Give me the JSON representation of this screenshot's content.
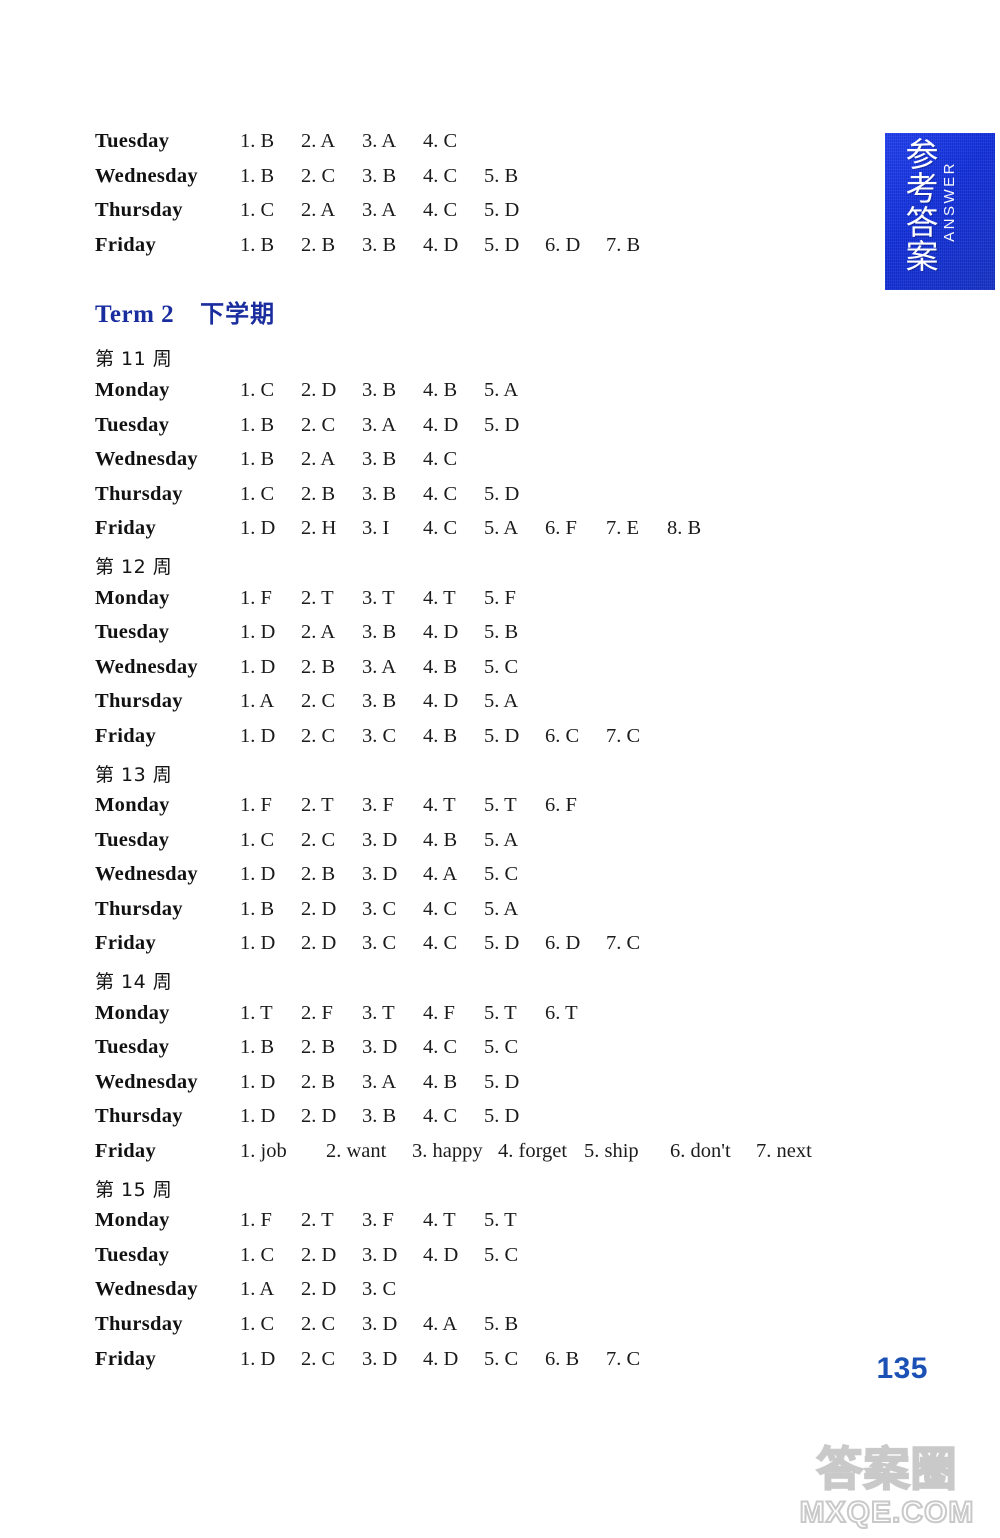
{
  "side_tab": {
    "chinese_label": "参考答案",
    "english_label": "ANSWER",
    "color": "#1432e6"
  },
  "top_block": {
    "rows": [
      {
        "day": "Tuesday",
        "answers": [
          "1. B",
          "2. A",
          "3. A",
          "4. C"
        ]
      },
      {
        "day": "Wednesday",
        "answers": [
          "1. B",
          "2. C",
          "3. B",
          "4. C",
          "5. B"
        ]
      },
      {
        "day": "Thursday",
        "answers": [
          "1. C",
          "2. A",
          "3. A",
          "4. C",
          "5. D"
        ]
      },
      {
        "day": "Friday",
        "answers": [
          "1. B",
          "2. B",
          "3. B",
          "4. D",
          "5. D",
          "6. D",
          "7. B"
        ]
      }
    ]
  },
  "term": {
    "english": "Term 2",
    "chinese": "下学期",
    "color": "#1a2d9e"
  },
  "weeks": [
    {
      "heading": "第 11 周",
      "rows": [
        {
          "day": "Monday",
          "answers": [
            "1. C",
            "2. D",
            "3. B",
            "4. B",
            "5. A"
          ]
        },
        {
          "day": "Tuesday",
          "answers": [
            "1. B",
            "2. C",
            "3. A",
            "4. D",
            "5. D"
          ]
        },
        {
          "day": "Wednesday",
          "answers": [
            "1. B",
            "2. A",
            "3. B",
            "4. C"
          ]
        },
        {
          "day": "Thursday",
          "answers": [
            "1. C",
            "2. B",
            "3. B",
            "4. C",
            "5. D"
          ]
        },
        {
          "day": "Friday",
          "answers": [
            "1. D",
            "2. H",
            "3. I",
            "4. C",
            "5. A",
            "6. F",
            "7. E",
            "8. B"
          ]
        }
      ]
    },
    {
      "heading": "第 12 周",
      "rows": [
        {
          "day": "Monday",
          "answers": [
            "1. F",
            "2. T",
            "3. T",
            "4. T",
            "5. F"
          ]
        },
        {
          "day": "Tuesday",
          "answers": [
            "1. D",
            "2. A",
            "3. B",
            "4. D",
            "5. B"
          ]
        },
        {
          "day": "Wednesday",
          "answers": [
            "1. D",
            "2. B",
            "3. A",
            "4. B",
            "5. C"
          ]
        },
        {
          "day": "Thursday",
          "answers": [
            "1. A",
            "2. C",
            "3. B",
            "4. D",
            "5. A"
          ]
        },
        {
          "day": "Friday",
          "answers": [
            "1. D",
            "2. C",
            "3. C",
            "4. B",
            "5. D",
            "6. C",
            "7. C"
          ]
        }
      ]
    },
    {
      "heading": "第 13 周",
      "rows": [
        {
          "day": "Monday",
          "answers": [
            "1. F",
            "2. T",
            "3. F",
            "4. T",
            "5. T",
            "6. F"
          ]
        },
        {
          "day": "Tuesday",
          "answers": [
            "1. C",
            "2. C",
            "3. D",
            "4. B",
            "5. A"
          ]
        },
        {
          "day": "Wednesday",
          "answers": [
            "1. D",
            "2. B",
            "3. D",
            "4. A",
            "5. C"
          ]
        },
        {
          "day": "Thursday",
          "answers": [
            "1. B",
            "2. D",
            "3. C",
            "4. C",
            "5. A"
          ]
        },
        {
          "day": "Friday",
          "answers": [
            "1. D",
            "2. D",
            "3. C",
            "4. C",
            "5. D",
            "6. D",
            "7. C"
          ]
        }
      ]
    },
    {
      "heading": "第 14 周",
      "rows": [
        {
          "day": "Monday",
          "answers": [
            "1. T",
            "2. F",
            "3. T",
            "4. F",
            "5. T",
            "6. T"
          ]
        },
        {
          "day": "Tuesday",
          "answers": [
            "1. B",
            "2. B",
            "3. D",
            "4. C",
            "5. C"
          ]
        },
        {
          "day": "Wednesday",
          "answers": [
            "1. D",
            "2. B",
            "3. A",
            "4. B",
            "5. D"
          ]
        },
        {
          "day": "Thursday",
          "answers": [
            "1. D",
            "2. D",
            "3. B",
            "4. C",
            "5. D"
          ]
        },
        {
          "day": "Friday",
          "wide": true,
          "answers": [
            "1. job",
            "2. want",
            "3. happy",
            "4. forget",
            "5. ship",
            "6. don't",
            "7. next"
          ]
        }
      ]
    },
    {
      "heading": "第 15 周",
      "rows": [
        {
          "day": "Monday",
          "answers": [
            "1. F",
            "2. T",
            "3. F",
            "4. T",
            "5. T"
          ]
        },
        {
          "day": "Tuesday",
          "answers": [
            "1. C",
            "2. D",
            "3. D",
            "4. D",
            "5. C"
          ]
        },
        {
          "day": "Wednesday",
          "answers": [
            "1. A",
            "2. D",
            "3. C"
          ]
        },
        {
          "day": "Thursday",
          "answers": [
            "1. C",
            "2. C",
            "3. D",
            "4. A",
            "5. B"
          ]
        },
        {
          "day": "Friday",
          "answers": [
            "1. D",
            "2. C",
            "3. D",
            "4. D",
            "5. C",
            "6. B",
            "7. C"
          ]
        }
      ]
    }
  ],
  "page_number": "135",
  "watermark": {
    "chinese": "答案圈",
    "url": "MXQE.COM"
  }
}
